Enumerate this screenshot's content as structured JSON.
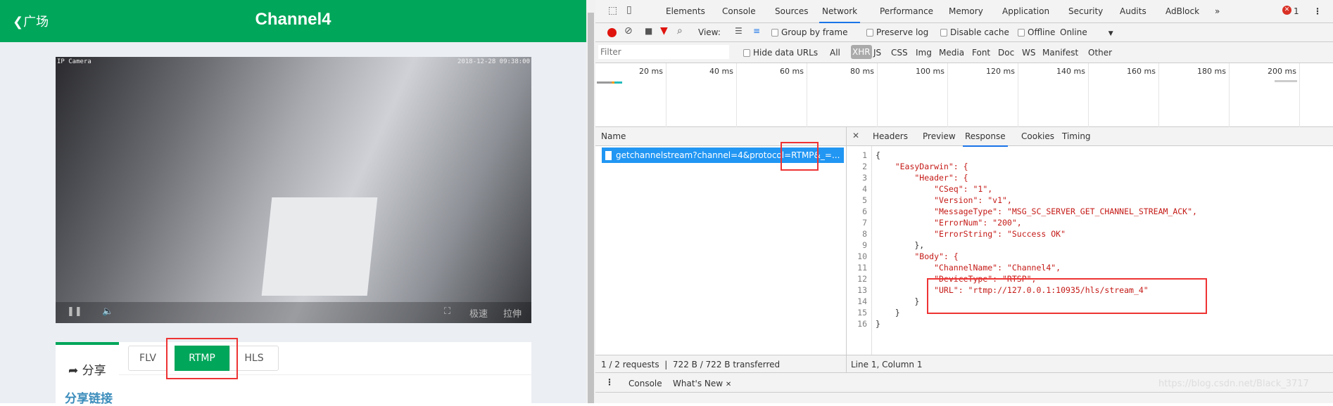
{
  "page": {
    "back_label": "广场",
    "title": "Channel4"
  },
  "video": {
    "camera_label": "IP Camera",
    "timestamp": "2018-12-28 09:38:00",
    "speed_label": "极速",
    "stretch_label": "拉伸",
    "pause_icon": "pause-icon",
    "volume_icon": "volume-icon"
  },
  "share": {
    "tab_label": "分享",
    "protocols": [
      "FLV",
      "RTMP",
      "HLS"
    ],
    "selected": "RTMP",
    "link_heading": "分享链接"
  },
  "devtools": {
    "tabs": [
      "Elements",
      "Console",
      "Sources",
      "Network",
      "Performance",
      "Memory",
      "Application",
      "Security",
      "Audits",
      "AdBlock"
    ],
    "active_tab": "Network",
    "error_count": "1",
    "toolbar": {
      "view_label": "View:",
      "group_by_frame": "Group by frame",
      "preserve_log": "Preserve log",
      "disable_cache": "Disable cache",
      "offline": "Offline",
      "throttle": "Online"
    },
    "filter": {
      "placeholder": "Filter",
      "hide_data_urls": "Hide data URLs",
      "types": [
        "All",
        "XHR",
        "JS",
        "CSS",
        "Img",
        "Media",
        "Font",
        "Doc",
        "WS",
        "Manifest",
        "Other"
      ],
      "active_type": "XHR"
    },
    "timeline_ticks": [
      "20 ms",
      "40 ms",
      "60 ms",
      "80 ms",
      "100 ms",
      "120 ms",
      "140 ms",
      "160 ms",
      "180 ms",
      "200 ms"
    ],
    "name_header": "Name",
    "request": "getchannelstream?channel=4&protocol=RTMP&_=...",
    "detail_tabs": [
      "Headers",
      "Preview",
      "Response",
      "Cookies",
      "Timing"
    ],
    "active_detail_tab": "Response",
    "response_lines": [
      "{",
      "    \"EasyDarwin\": {",
      "        \"Header\": {",
      "            \"CSeq\": \"1\",",
      "            \"Version\": \"v1\",",
      "            \"MessageType\": \"MSG_SC_SERVER_GET_CHANNEL_STREAM_ACK\",",
      "            \"ErrorNum\": \"200\",",
      "            \"ErrorString\": \"Success OK\"",
      "        },",
      "        \"Body\": {",
      "            \"ChannelName\": \"Channel4\",",
      "            \"DeviceType\": \"RTSP\",",
      "            \"URL\": \"rtmp://127.0.0.1:10935/hls/stream_4\"",
      "        }",
      "    }",
      "}"
    ],
    "status": "1 / 2 requests  |  722 B / 722 B transferred",
    "cursor": "Line 1, Column 1",
    "drawer_tabs": [
      "Console",
      "What's New"
    ],
    "watermark": "https://blog.csdn.net/Black_3717"
  },
  "colors": {
    "brand_green": "#00a65a",
    "highlight_red": "#e33333",
    "selected_row": "#2196f3"
  }
}
